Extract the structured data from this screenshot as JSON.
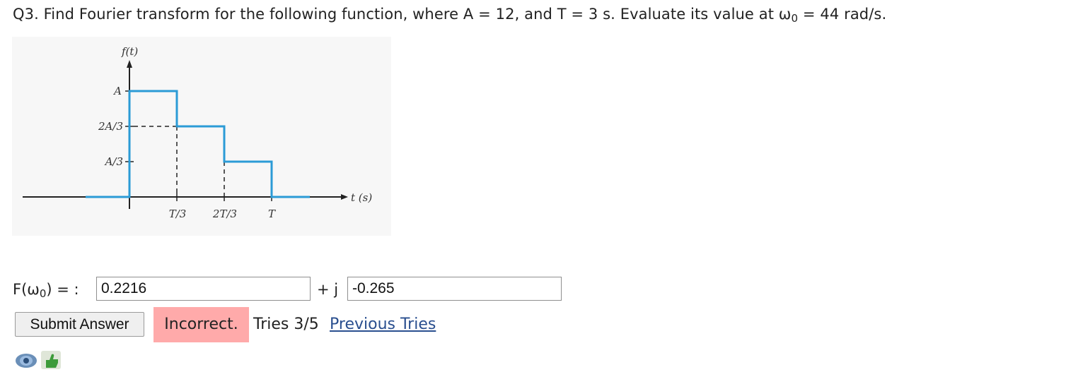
{
  "question": {
    "text_before_sub": "Q3. Find Fourier transform for the following function, where A = 12, and T = 3 s. Evaluate its value at ω",
    "sub": "0",
    "text_after_sub": " = 44 rad/s."
  },
  "figure": {
    "y_axis_label": "f(t)",
    "x_axis_label": "t (s)",
    "y_ticks": [
      "A",
      "2A/3",
      "A/3"
    ],
    "x_ticks": [
      "T/3",
      "2T/3",
      "T"
    ],
    "colors": {
      "signal": "#2b9bd6",
      "axis": "#222222"
    }
  },
  "answer": {
    "label_prefix": "F(ω",
    "label_sub": "0",
    "label_suffix": ") = :",
    "real_value": "0.2216",
    "plus_j": "+ j",
    "imag_value": "-0.265"
  },
  "controls": {
    "submit_label": "Submit Answer",
    "status": "Incorrect.",
    "tries": "Tries 3/5",
    "previous_tries": "Previous Tries",
    "status_color": "#ffaaaa"
  },
  "icons": [
    "eye-icon",
    "thumbs-up-icon"
  ]
}
